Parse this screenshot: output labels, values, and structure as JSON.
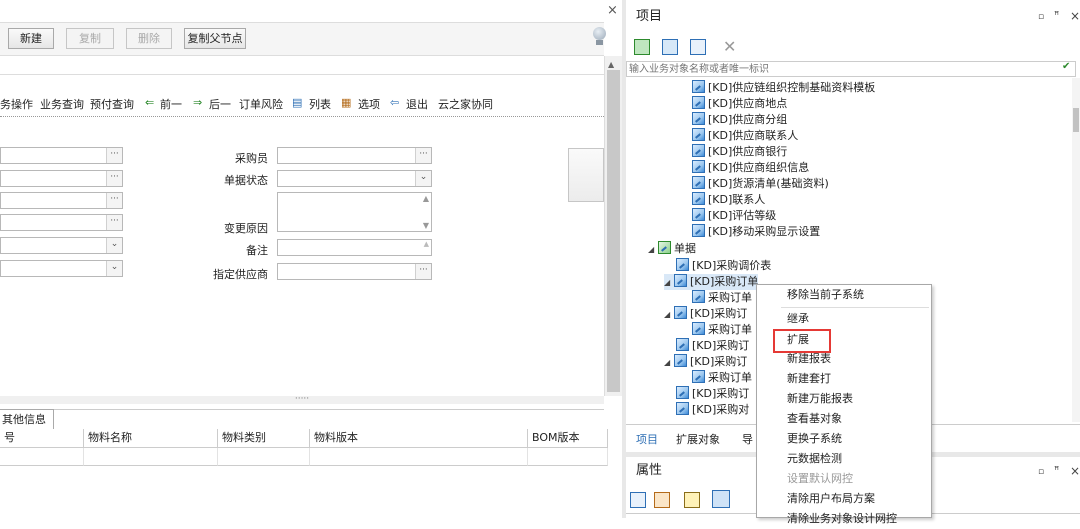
{
  "left": {
    "toolbar": {
      "new": "新建",
      "copy": "复制",
      "delete": "删除",
      "copy_parent": "复制父节点"
    },
    "menu_bar": {
      "business_ops": "务操作",
      "business_query": "业务查询",
      "prepay_query": "预付查询",
      "prev": "前一",
      "next": "后一",
      "order_risk": "订单风险",
      "list": "列表",
      "options": "选项",
      "exit": "退出",
      "cloud_collab": "云之家协同"
    },
    "form": {
      "buyer_label": "采购员",
      "status_label": "单据状态",
      "change_reason_label": "变更原因",
      "remark_label": "备注",
      "supplier_label": "指定供应商",
      "ellipsis": "···",
      "dropdown": "⌄"
    },
    "splitter_dots": "·····",
    "bottom_tab": "其他信息",
    "grid_headers": [
      "号",
      "物料名称",
      "物料类别",
      "物料版本",
      "BOM版本"
    ]
  },
  "right": {
    "project_panel": {
      "title": "项目",
      "search_placeholder": "输入业务对象名称或者唯一标识",
      "tree_items": [
        "[KD]供应链组织控制基础资料模板",
        "[KD]供应商地点",
        "[KD]供应商分组",
        "[KD]供应商联系人",
        "[KD]供应商银行",
        "[KD]供应商组织信息",
        "[KD]货源清单(基础资料)",
        "[KD]联系人",
        "[KD]评估等级",
        "[KD]移动采购显示设置"
      ],
      "doc_group": "单据",
      "doc_items": [
        "[KD]采购调价表",
        "[KD]采购订单",
        "采购订单",
        "[KD]采购订",
        "采购订单",
        "[KD]采购订",
        "[KD]采购订",
        "采购订单",
        "[KD]采购订",
        "[KD]采购对"
      ],
      "tabs": [
        "项目",
        "扩展对象",
        "导"
      ]
    },
    "props_panel": {
      "title": "属性"
    },
    "window_controls": [
      "▫",
      "ꟸ",
      "×"
    ]
  },
  "context_menu": {
    "items": [
      {
        "label": "移除当前子系统",
        "enabled": true
      },
      {
        "label": "继承",
        "enabled": true
      },
      {
        "label": "扩展",
        "enabled": true
      },
      {
        "label": "新建报表",
        "enabled": true
      },
      {
        "label": "新建套打",
        "enabled": true
      },
      {
        "label": "新建万能报表",
        "enabled": true
      },
      {
        "label": "查看基对象",
        "enabled": true
      },
      {
        "label": "更换子系统",
        "enabled": true
      },
      {
        "label": "元数据检测",
        "enabled": true
      },
      {
        "label": "设置默认网控",
        "enabled": false
      },
      {
        "label": "清除用户布局方案",
        "enabled": true
      },
      {
        "label": "清除业务对象设计网控",
        "enabled": true
      }
    ],
    "highlighted": "扩展",
    "highlight_color": "#e53935"
  },
  "close_x": "×"
}
